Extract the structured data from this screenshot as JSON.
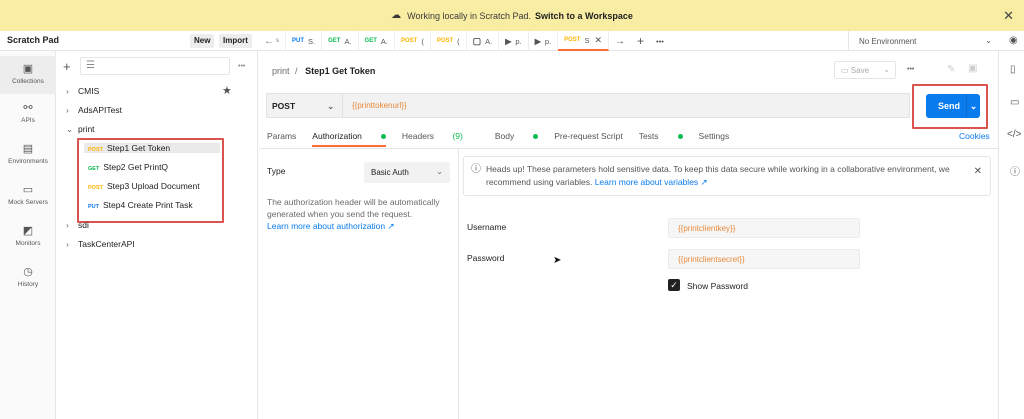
{
  "banner": {
    "text": "Working locally in Scratch Pad.",
    "link": "Switch to a Workspace"
  },
  "workspace": {
    "title": "Scratch Pad",
    "new_label": "New",
    "import_label": "Import"
  },
  "tabs": [
    {
      "method": "PUT",
      "label": "S."
    },
    {
      "method": "GET",
      "label": "A."
    },
    {
      "method": "GET",
      "label": "A."
    },
    {
      "method": "POST",
      "label": "("
    },
    {
      "method": "POST",
      "label": "("
    },
    {
      "method": "",
      "label": "A."
    },
    {
      "method": "",
      "label": "p."
    },
    {
      "method": "",
      "label": "p."
    },
    {
      "method": "POST",
      "label": "S"
    }
  ],
  "environment": "No Environment",
  "sidebar_nav": [
    {
      "label": "Collections"
    },
    {
      "label": "APIs"
    },
    {
      "label": "Environments"
    },
    {
      "label": "Mock Servers"
    },
    {
      "label": "Monitors"
    },
    {
      "label": "History"
    }
  ],
  "tree": {
    "cmis": "CMIS",
    "ads": "AdsAPITest",
    "print": "print",
    "requests": [
      {
        "method": "POST",
        "label": "Step1 Get Token"
      },
      {
        "method": "GET",
        "label": "Step2 Get PrintQ"
      },
      {
        "method": "POST",
        "label": "Step3 Upload Document"
      },
      {
        "method": "PUT",
        "label": "Step4 Create Print Task"
      }
    ],
    "sdi": "sdi",
    "taskcenter": "TaskCenterAPI"
  },
  "breadcrumb": {
    "parent": "print",
    "sep": "/",
    "current": "Step1 Get Token"
  },
  "save_label": "Save",
  "request": {
    "method": "POST",
    "url": "{{printtokenurl}}",
    "send_label": "Send"
  },
  "subtabs": {
    "params": "Params",
    "authorization": "Authorization",
    "headers": "Headers",
    "headers_count": "(9)",
    "body": "Body",
    "prerequest": "Pre-request Script",
    "tests": "Tests",
    "settings": "Settings",
    "cookies": "Cookies"
  },
  "auth": {
    "type_label": "Type",
    "type_value": "Basic Auth",
    "desc": "The authorization header will be automatically generated when you send the request.",
    "learn_more": "Learn more about authorization ↗",
    "alert_text": "Heads up! These parameters hold sensitive data. To keep this data secure while working in a collaborative environment, we recommend using variables.",
    "alert_link": "Learn more about variables ↗",
    "username_label": "Username",
    "username_value": "{{printclientkey}}",
    "password_label": "Password",
    "password_value": "{{printclientsecret}}",
    "show_password": "Show Password"
  },
  "colors": {
    "accent": "#ff6c37",
    "send": "#097bed",
    "highlight": "#d9534f",
    "banner": "#f9eda3"
  }
}
